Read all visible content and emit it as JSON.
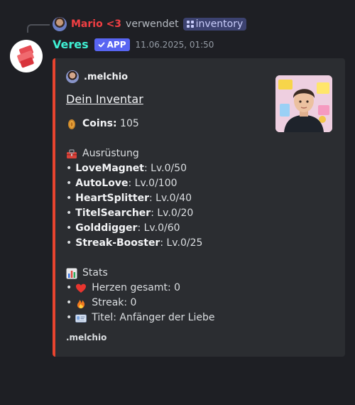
{
  "reply": {
    "user": "Mario <3",
    "action": "verwendet",
    "command": "inventory"
  },
  "message": {
    "author": "Veres",
    "badge": "APP",
    "timestamp": "11.06.2025, 01:50"
  },
  "embed": {
    "accent_color": "#e8442f",
    "author_name": ".melchio",
    "title": "Dein Inventar",
    "coins": {
      "label": "Coins:",
      "value": "105",
      "icon": "coin-icon"
    },
    "equipment_heading": "Ausrüstung",
    "equipment": [
      {
        "name": "LoveMagnet",
        "level": ": Lv.0/50"
      },
      {
        "name": "AutoLove",
        "level": ": Lv.0/100"
      },
      {
        "name": "HeartSplitter",
        "level": ": Lv.0/40"
      },
      {
        "name": "TitelSearcher",
        "level": ": Lv.0/20"
      },
      {
        "name": "Golddigger",
        "level": ": Lv.0/60"
      },
      {
        "name": "Streak-Booster",
        "level": ": Lv.0/25"
      }
    ],
    "stats_heading": "Stats",
    "stats": [
      {
        "icon": "heart-icon",
        "text": "Herzen gesamt: 0"
      },
      {
        "icon": "fire-icon",
        "text": "Streak: 0"
      },
      {
        "icon": "id-card-icon",
        "text": "Titel: Anfänger der Liebe"
      }
    ],
    "footer": ".melchio"
  }
}
